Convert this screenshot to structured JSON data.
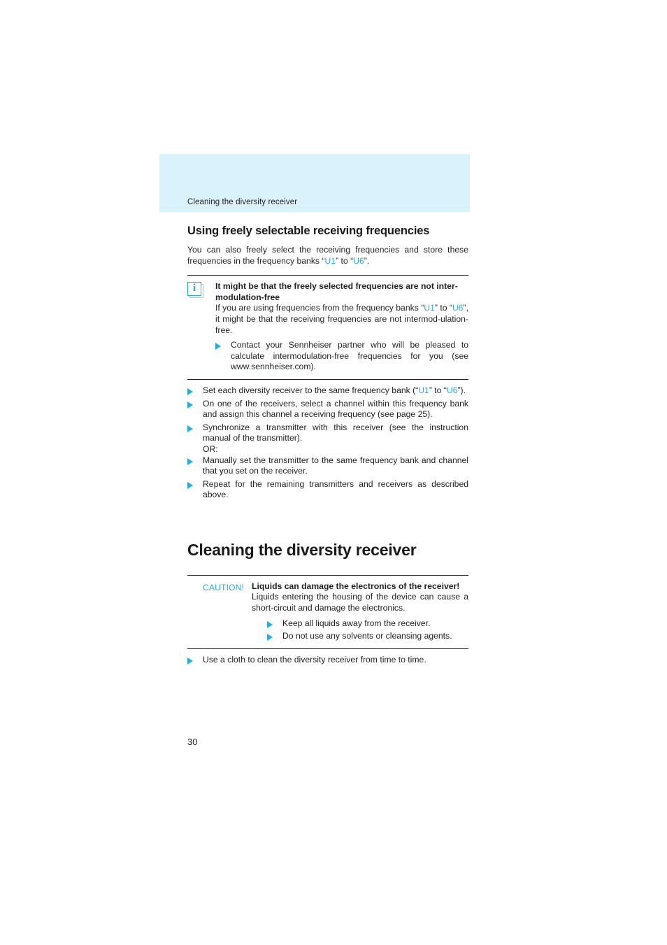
{
  "running_header": {
    "text": "Cleaning the diversity receiver"
  },
  "section_freq": {
    "heading": "Using freely selectable receiving frequencies",
    "intro_part1": "You can also freely select the receiving frequencies and store these frequencies in the frequency banks “",
    "intro_bank_from": "U1",
    "intro_mid": "” to “",
    "intro_bank_to": "U6",
    "intro_end": "”."
  },
  "note_box": {
    "icon": "info-icon",
    "icon_glyph": "i",
    "title": "It might be that the freely selected frequencies are not inter-modulation-free",
    "body_part1": "If you are using frequencies from the frequency banks “",
    "body_bank_from": "U1",
    "body_mid": "” to “",
    "body_bank_to": "U6",
    "body_end": "”, it might be that the receiving frequencies are not intermod-ulation-free.",
    "bullets": [
      "Contact your Sennheiser partner who will be pleased to calculate intermodulation-free frequencies for you (see www.sennheiser.com)."
    ]
  },
  "steps": {
    "item1_part1": "Set each diversity receiver to the same frequency bank (“",
    "item1_bank_from": "U1",
    "item1_mid": "” to “",
    "item1_bank_to": "U6",
    "item1_end": "”).",
    "item2": "On one of the receivers, select a channel within this frequency bank and assign this channel a receiving frequency (see page 25).",
    "item3": "Synchronize a transmitter with this receiver (see the instruction manual of the transmitter).",
    "or_label": "OR:",
    "item4": "Manually set the transmitter to the same frequency bank and channel that you set on the receiver.",
    "item5": "Repeat for the remaining transmitters and receivers as described above."
  },
  "section_cleaning": {
    "heading": "Cleaning the diversity receiver"
  },
  "caution_box": {
    "label": "CAUTION!",
    "title": "Liquids can damage the electronics of the receiver!",
    "body": "Liquids entering the housing of the device can cause a short-circuit and damage the electronics.",
    "bullets": [
      "Keep all liquids away from the receiver.",
      "Do not use any solvents or cleansing agents."
    ]
  },
  "final_step": {
    "text": "Use a cloth to clean the diversity receiver from time to time."
  },
  "folio": {
    "page_number": "30"
  },
  "colors": {
    "accent": "#29abe2",
    "header_band": "#daf2fc",
    "text": "#231f20"
  }
}
